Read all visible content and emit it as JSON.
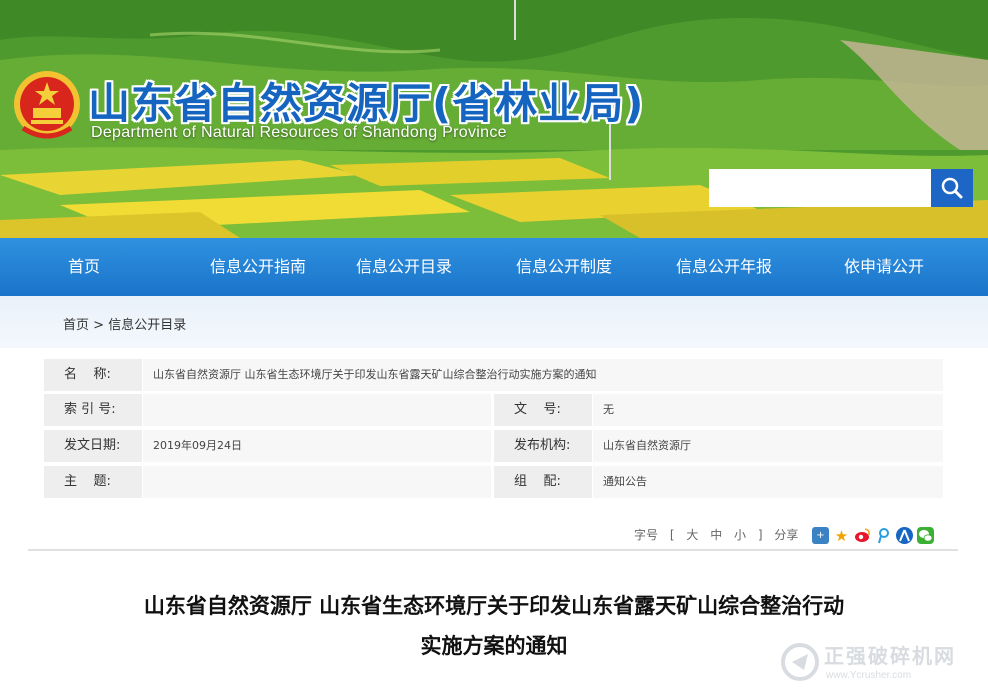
{
  "header": {
    "title": "山东省自然资源厅(省林业局)",
    "subtitle": "Department of Natural Resources of Shandong Province"
  },
  "search": {
    "placeholder": "",
    "value": ""
  },
  "nav": {
    "items": [
      "首页",
      "信息公开指南",
      "信息公开目录",
      "信息公开制度",
      "信息公开年报",
      "依申请公开"
    ]
  },
  "breadcrumb": {
    "home": "首页",
    "separator": ">",
    "current": "信息公开目录"
  },
  "info": {
    "name_label": "名    称:",
    "name_value": "山东省自然资源厅 山东省生态环境厅关于印发山东省露天矿山综合整治行动实施方案的通知",
    "index_label": "索 引 号:",
    "index_value": "",
    "docno_label": "文    号:",
    "docno_value": "无",
    "date_label": "发文日期:",
    "date_value": "2019年09月24日",
    "org_label": "发布机构:",
    "org_value": "山东省自然资源厅",
    "topic_label": "主    题:",
    "topic_value": "",
    "group_label": "组    配:",
    "group_value": "通知公告"
  },
  "tools": {
    "font_label": "字号",
    "bracket_open": "[",
    "large": "大",
    "medium": "中",
    "small": "小",
    "bracket_close": "]",
    "share_label": "分享"
  },
  "share_icons": [
    "plus-share-icon",
    "star-icon",
    "weibo-icon",
    "tencent-weibo-icon",
    "renren-icon",
    "wechat-icon"
  ],
  "article": {
    "title_line1": "山东省自然资源厅 山东省生态环境厅关于印发山东省露天矿山综合整治行动",
    "title_line2": "实施方案的通知"
  },
  "watermark": {
    "text": "正强破碎机网",
    "sub": "www.Ycrusher.com"
  },
  "colors": {
    "title_blue": "#1565c0",
    "nav_blue": "#1a74c9",
    "search_blue": "#1d66c6"
  }
}
